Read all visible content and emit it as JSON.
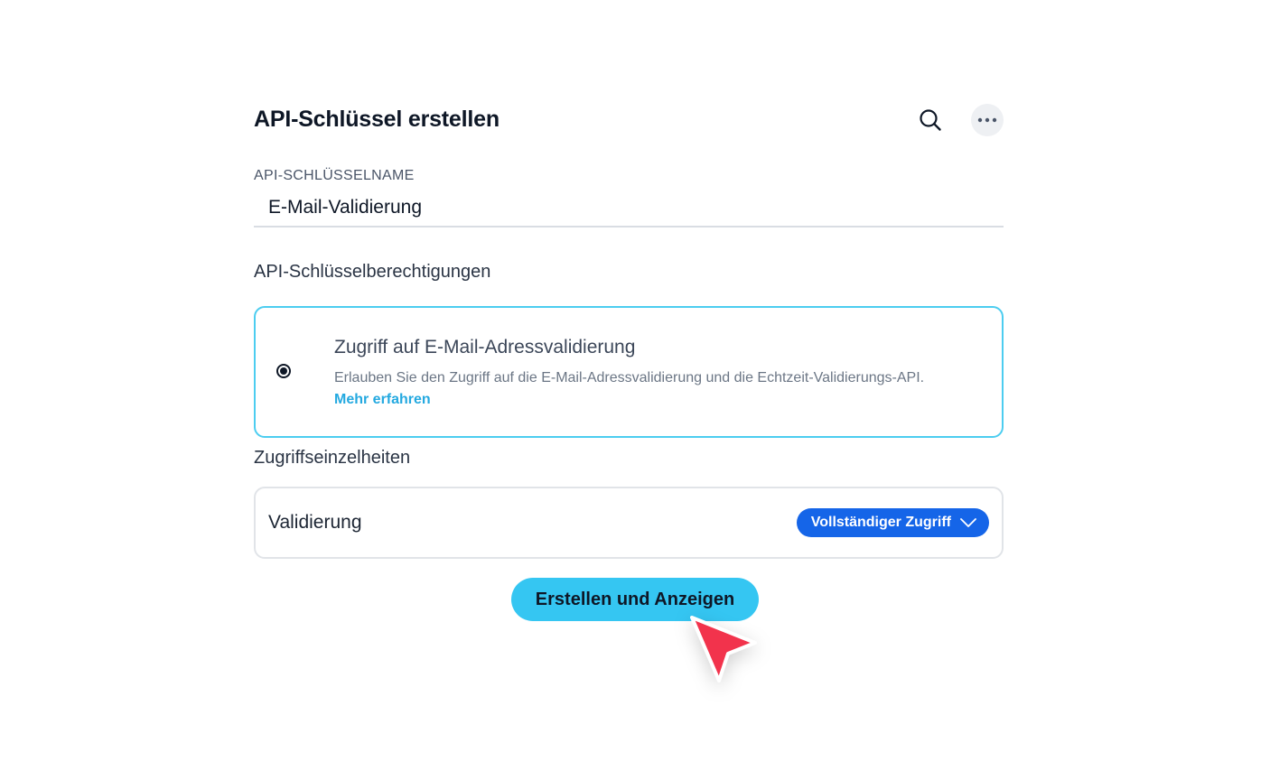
{
  "header": {
    "title": "API-Schlüssel erstellen",
    "search_icon": "search-icon",
    "more_icon": "more-horizontal-icon"
  },
  "name_field": {
    "label": "API-SCHLÜSSELNAME",
    "value": "E-Mail-Validierung"
  },
  "permissions": {
    "title": "API-Schlüsselberechtigungen",
    "option": {
      "selected": true,
      "name": "Zugriff auf E-Mail-Adressvalidierung",
      "description": "Erlauben Sie den Zugriff auf die E-Mail-Adressvalidierung und die Echtzeit-Validierungs-API.",
      "link": "Mehr erfahren"
    }
  },
  "details": {
    "title": "Zugriffseinzelheiten",
    "row_label": "Validierung",
    "access_value": "Vollständiger Zugriff",
    "access_icon": "chevron-down-icon"
  },
  "submit_button": {
    "label": "Erstellen und Anzeigen"
  },
  "colors": {
    "accent": "#35c6f2",
    "select_bg": "#1565e8",
    "link": "#24a9e0",
    "card_border_selected": "#4ccdf0",
    "cursor": "#f2334c"
  }
}
